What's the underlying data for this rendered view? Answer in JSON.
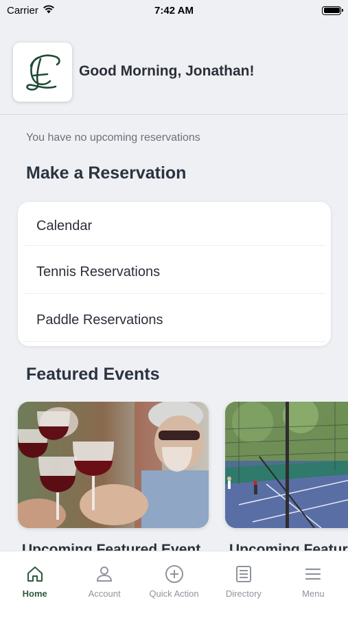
{
  "status_bar": {
    "carrier": "Carrier",
    "time": "7:42 AM"
  },
  "header": {
    "greeting": "Good Morning, Jonathan!"
  },
  "reservations": {
    "empty_message": "You have no upcoming reservations",
    "title": "Make a Reservation",
    "items": [
      {
        "label": "Calendar"
      },
      {
        "label": "Tennis Reservations"
      },
      {
        "label": "Paddle Reservations"
      }
    ]
  },
  "events": {
    "title": "Featured Events",
    "cards": [
      {
        "title": "Upcoming Featured Event"
      },
      {
        "title": "Upcoming Featured Event"
      }
    ]
  },
  "tab_bar": {
    "tabs": [
      {
        "label": "Home",
        "icon": "home-icon",
        "active": true
      },
      {
        "label": "Account",
        "icon": "person-icon",
        "active": false
      },
      {
        "label": "Quick Action",
        "icon": "plus-circle-icon",
        "active": false
      },
      {
        "label": "Directory",
        "icon": "list-icon",
        "active": false
      },
      {
        "label": "Menu",
        "icon": "hamburger-icon",
        "active": false
      }
    ]
  },
  "colors": {
    "brand": "#2d5a3d",
    "background": "#eef0f4"
  }
}
